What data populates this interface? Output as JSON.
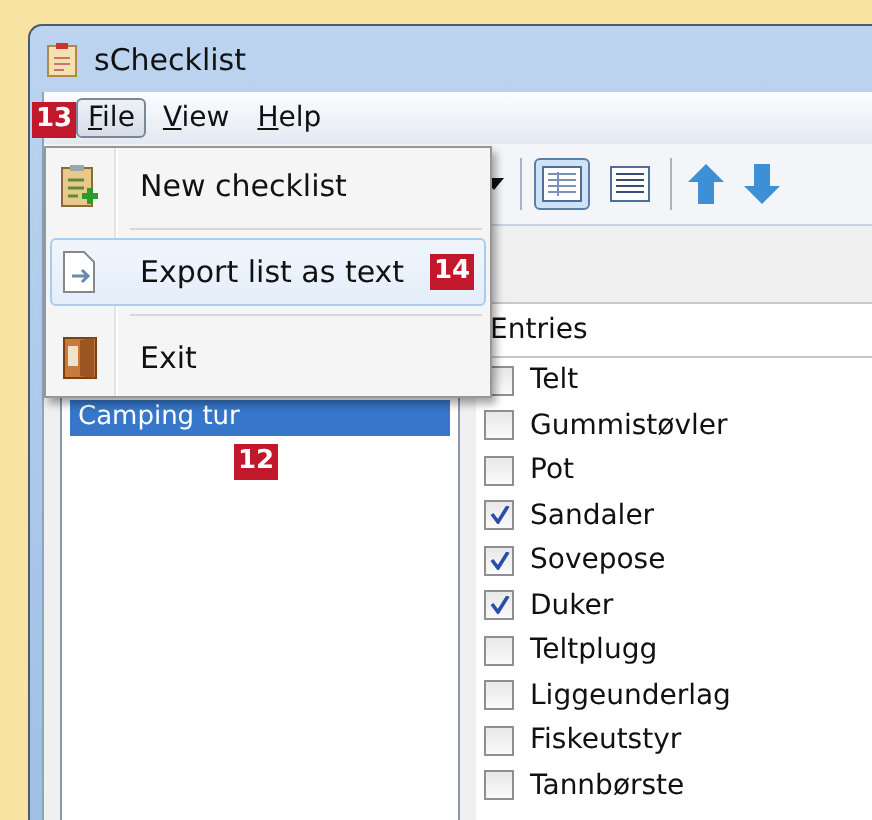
{
  "window": {
    "title": "sChecklist"
  },
  "menu_bar": [
    {
      "label": "File",
      "selected": true
    },
    {
      "label": "View",
      "selected": false
    },
    {
      "label": "Help",
      "selected": false
    }
  ],
  "file_menu": [
    {
      "kind": "new",
      "label": "New checklist",
      "selected": false
    },
    {
      "kind": "export",
      "label": "Export list as text",
      "selected": true
    },
    {
      "kind": "exit",
      "label": "Exit",
      "selected": false
    }
  ],
  "toolbar": {
    "views": [
      {
        "kind": "details",
        "selected": true
      },
      {
        "kind": "list",
        "selected": false
      }
    ]
  },
  "checklists": [
    {
      "name": "Camping tur",
      "selected": true
    }
  ],
  "entries": {
    "header": "Entries",
    "items": [
      {
        "label": "Telt",
        "checked": false
      },
      {
        "label": "Gummistøvler",
        "checked": false
      },
      {
        "label": "Pot",
        "checked": false
      },
      {
        "label": "Sandaler",
        "checked": true
      },
      {
        "label": "Sovepose",
        "checked": true
      },
      {
        "label": "Duker",
        "checked": true
      },
      {
        "label": "Teltplugg",
        "checked": false
      },
      {
        "label": "Liggeunderlag",
        "checked": false
      },
      {
        "label": "Fiskeutstyr",
        "checked": false
      },
      {
        "label": "Tannbørste",
        "checked": false
      }
    ]
  },
  "annotations": [
    "13",
    "14",
    "12"
  ]
}
